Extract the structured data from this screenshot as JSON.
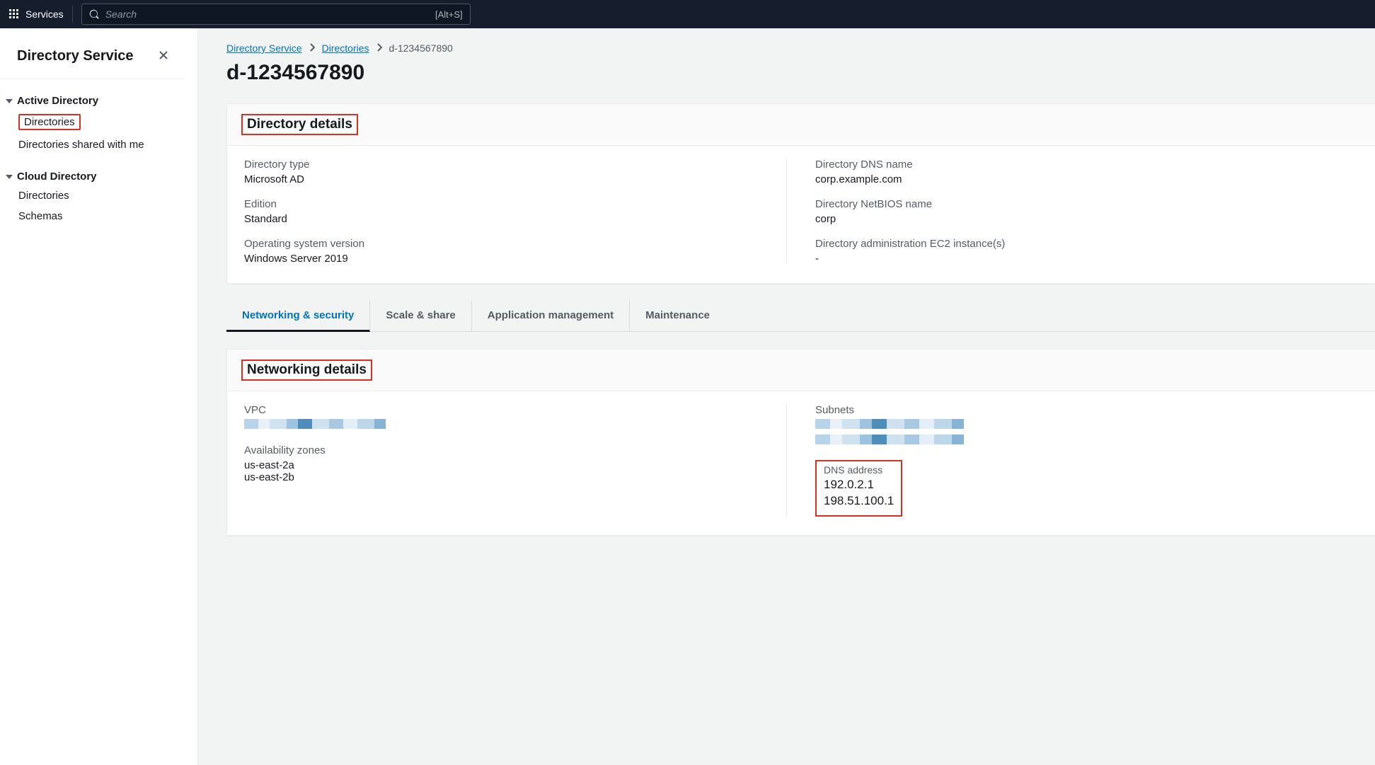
{
  "topbar": {
    "services_label": "Services",
    "search_placeholder": "Search",
    "search_hint": "[Alt+S]"
  },
  "sidebar": {
    "title": "Directory Service",
    "groups": [
      {
        "label": "Active Directory",
        "items": [
          {
            "label": "Directories",
            "highlighted": true
          },
          {
            "label": "Directories shared with me"
          }
        ]
      },
      {
        "label": "Cloud Directory",
        "items": [
          {
            "label": "Directories"
          },
          {
            "label": "Schemas"
          }
        ]
      }
    ]
  },
  "breadcrumbs": {
    "root": "Directory Service",
    "second": "Directories",
    "current": "d-1234567890"
  },
  "page_title": "d-1234567890",
  "details_panel": {
    "heading": "Directory details",
    "left": [
      {
        "label": "Directory type",
        "value": "Microsoft AD"
      },
      {
        "label": "Edition",
        "value": "Standard"
      },
      {
        "label": "Operating system version",
        "value": "Windows Server 2019"
      }
    ],
    "right": [
      {
        "label": "Directory DNS name",
        "value": "corp.example.com"
      },
      {
        "label": "Directory NetBIOS name",
        "value": "corp"
      },
      {
        "label": "Directory administration EC2 instance(s)",
        "value": "-"
      }
    ]
  },
  "tabs": [
    {
      "label": "Networking & security",
      "active": true
    },
    {
      "label": "Scale & share"
    },
    {
      "label": "Application management"
    },
    {
      "label": "Maintenance"
    }
  ],
  "networking_panel": {
    "heading": "Networking details",
    "vpc_label": "VPC",
    "subnets_label": "Subnets",
    "az_label": "Availability zones",
    "az_values": [
      "us-east-2a",
      "us-east-2b"
    ],
    "dns_label": "DNS address",
    "dns_values": [
      "192.0.2.1",
      "198.51.100.1"
    ]
  }
}
